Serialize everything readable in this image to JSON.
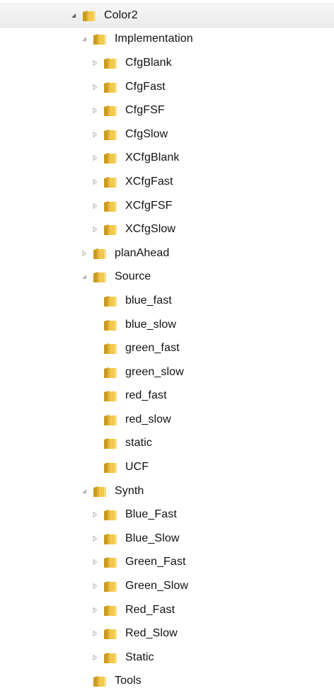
{
  "tree": {
    "root": {
      "label": "Color2",
      "state": "expanded",
      "selected": true
    },
    "implementation": {
      "label": "Implementation",
      "state": "expanded",
      "children": [
        "CfgBlank",
        "CfgFast",
        "CfgFSF",
        "CfgSlow",
        "XCfgBlank",
        "XCfgFast",
        "XCfgFSF",
        "XCfgSlow"
      ]
    },
    "planahead": {
      "label": "planAhead",
      "state": "collapsed"
    },
    "source": {
      "label": "Source",
      "state": "expanded",
      "children": [
        "blue_fast",
        "blue_slow",
        "green_fast",
        "green_slow",
        "red_fast",
        "red_slow",
        "static",
        "UCF"
      ]
    },
    "synth": {
      "label": "Synth",
      "state": "expanded",
      "children": [
        "Blue_Fast",
        "Blue_Slow",
        "Green_Fast",
        "Green_Slow",
        "Red_Fast",
        "Red_Slow",
        "Static"
      ]
    },
    "tools": {
      "label": "Tools",
      "state": "leaf"
    }
  },
  "icons": {
    "expanded_arrow": "triangle-down-right-icon",
    "collapsed_arrow": "triangle-right-outline-icon",
    "folder": "folder-icon"
  },
  "colors": {
    "selection_bg": "#ececec",
    "folder_yellow": "#f2c94c",
    "folder_dark": "#c99a1e",
    "arrow_filled": "#5f5f5f",
    "arrow_outline": "#b5b5b5"
  }
}
